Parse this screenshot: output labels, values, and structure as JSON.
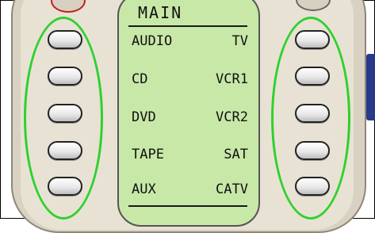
{
  "screen": {
    "title": "MAIN",
    "left_labels": [
      "AUDIO",
      "CD",
      "DVD",
      "TAPE",
      "AUX"
    ],
    "right_labels": [
      "TV",
      "VCR1",
      "VCR2",
      "SAT",
      "CATV"
    ]
  },
  "colors": {
    "lcd_background": "#c8e8a8",
    "highlight": "#2ed12e",
    "remote_body": "#d9d2c2",
    "power_ring": "#c02020",
    "side_tab": "#2a3a8a"
  }
}
